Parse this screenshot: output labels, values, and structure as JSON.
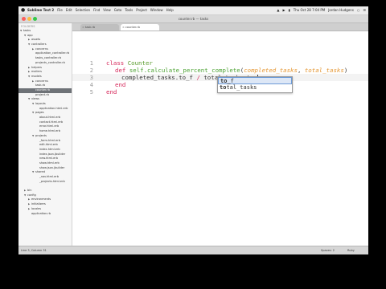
{
  "menubar": {
    "apple": "",
    "items": [
      "Sublime Text 2",
      "File",
      "Edit",
      "Selection",
      "Find",
      "View",
      "Goto",
      "Tools",
      "Project",
      "Window",
      "Help"
    ],
    "clock": "Thu Oct 28  7:04 PM",
    "user": "Jordan Hudgens"
  },
  "window": {
    "title": "counter.rb — tasks"
  },
  "sidebar": {
    "header": "FOLDERS",
    "items": [
      {
        "label": "tasks",
        "depth": 0,
        "arrow": "▼"
      },
      {
        "label": "app",
        "depth": 1,
        "arrow": "▼"
      },
      {
        "label": "assets",
        "depth": 2,
        "arrow": "▶"
      },
      {
        "label": "controllers",
        "depth": 2,
        "arrow": "▼"
      },
      {
        "label": "concerns",
        "depth": 3,
        "arrow": "▶"
      },
      {
        "label": "application_controller.rb",
        "depth": 3,
        "arrow": ""
      },
      {
        "label": "tasks_controller.rb",
        "depth": 3,
        "arrow": ""
      },
      {
        "label": "projects_controller.rb",
        "depth": 3,
        "arrow": ""
      },
      {
        "label": "helpers",
        "depth": 2,
        "arrow": "▶"
      },
      {
        "label": "mailers",
        "depth": 2,
        "arrow": "▶"
      },
      {
        "label": "models",
        "depth": 2,
        "arrow": "▼"
      },
      {
        "label": "concerns",
        "depth": 3,
        "arrow": "▶"
      },
      {
        "label": "task.rb",
        "depth": 3,
        "arrow": ""
      },
      {
        "label": "counter.rb",
        "depth": 3,
        "arrow": "",
        "selected": true
      },
      {
        "label": "project.rb",
        "depth": 3,
        "arrow": ""
      },
      {
        "label": "views",
        "depth": 2,
        "arrow": "▼"
      },
      {
        "label": "layouts",
        "depth": 3,
        "arrow": "▼"
      },
      {
        "label": "application.html.erb",
        "depth": 4,
        "arrow": ""
      },
      {
        "label": "pages",
        "depth": 3,
        "arrow": "▼"
      },
      {
        "label": "about.html.erb",
        "depth": 4,
        "arrow": ""
      },
      {
        "label": "contact.html.erb",
        "depth": 4,
        "arrow": ""
      },
      {
        "label": "error.html.erb",
        "depth": 4,
        "arrow": ""
      },
      {
        "label": "home.html.erb",
        "depth": 4,
        "arrow": ""
      },
      {
        "label": "projects",
        "depth": 3,
        "arrow": "▼"
      },
      {
        "label": "_form.html.erb",
        "depth": 4,
        "arrow": ""
      },
      {
        "label": "edit.html.erb",
        "depth": 4,
        "arrow": ""
      },
      {
        "label": "index.html.erb",
        "depth": 4,
        "arrow": ""
      },
      {
        "label": "index.json.jbuilder",
        "depth": 4,
        "arrow": ""
      },
      {
        "label": "new.html.erb",
        "depth": 4,
        "arrow": ""
      },
      {
        "label": "show.html.erb",
        "depth": 4,
        "arrow": ""
      },
      {
        "label": "show.json.jbuilder",
        "depth": 4,
        "arrow": ""
      },
      {
        "label": "shared",
        "depth": 3,
        "arrow": "▼"
      },
      {
        "label": "_nav.html.erb",
        "depth": 4,
        "arrow": ""
      },
      {
        "label": "_projects.html.erb",
        "depth": 4,
        "arrow": ""
      },
      {
        "label": "",
        "depth": 0,
        "arrow": ""
      },
      {
        "label": "bin",
        "depth": 1,
        "arrow": "▶"
      },
      {
        "label": "config",
        "depth": 1,
        "arrow": "▼"
      },
      {
        "label": "environments",
        "depth": 2,
        "arrow": "▶"
      },
      {
        "label": "initializers",
        "depth": 2,
        "arrow": "▶"
      },
      {
        "label": "locales",
        "depth": 2,
        "arrow": "▶"
      },
      {
        "label": "application.rb",
        "depth": 2,
        "arrow": ""
      }
    ]
  },
  "tabs": [
    {
      "label": "task.rb",
      "active": false
    },
    {
      "label": "counter.rb",
      "active": true
    }
  ],
  "editor": {
    "line_numbers": [
      "1",
      "2",
      "3",
      "4",
      "5"
    ],
    "line1": {
      "kw": "class",
      "name": "Counter"
    },
    "line2": {
      "kw": "def",
      "fn": "self.calculate_percent_complete",
      "open": "(",
      "p1": "completed_tasks",
      "comma": ", ",
      "p2": "total_tasks",
      "close": ")"
    },
    "line3": {
      "a": "completed_tasks.to_f",
      "op": "/",
      "b": "total_tasks.to_"
    },
    "line4": {
      "kw": "end"
    },
    "line5": {
      "kw": "end"
    }
  },
  "autocomplete": {
    "items": [
      {
        "bold": "to_",
        "rest": "f"
      },
      {
        "bold": "to",
        "rest": "tal_tasks"
      }
    ]
  },
  "statusbar": {
    "position": "Line 3, Column 31",
    "spaces": "Spaces: 2",
    "syntax": "Ruby"
  },
  "colors": {
    "keyword": "#d6295b",
    "function": "#4aa131",
    "parameter": "#e49530",
    "selected_row": "#6e7277"
  }
}
